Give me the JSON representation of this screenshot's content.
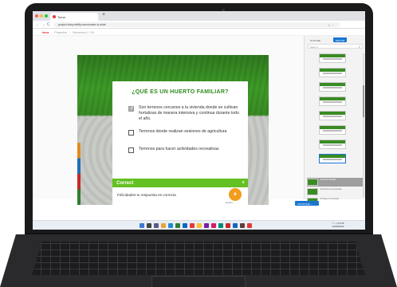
{
  "browser": {
    "tab_title": "Toma",
    "new_tab": "+",
    "url": "project-toby.netlify.com/create-is-slide",
    "nav_back": "←",
    "nav_forward": "→",
    "nav_reload": "C",
    "url_icons": "☆ ⋮"
  },
  "app": {
    "logo": "toma",
    "crumb_1": "Proyectos",
    "crumb_sep": "›",
    "crumb_2": "Secuencia 1 / 2/4"
  },
  "quiz": {
    "question": "¿QUÉ ES UN HUERTO FAMILIAR?",
    "options": [
      {
        "text": "Son terrenos cercanos a la vivienda donde se cultivan hortalizas de manera intensiva y continua durante todo el año.",
        "checked": true
      },
      {
        "text": "Terrenos donde realizan sesiones de agricultura",
        "checked": false
      },
      {
        "text": "Terrenos para hacer actividades recreativas",
        "checked": false
      }
    ]
  },
  "feedback": {
    "title": "Correct",
    "arrow": "∨",
    "message": "Felicidades tu respuesta es correcta",
    "logo_text": "Huerto"
  },
  "panel": {
    "tab_outline": "OUTLINE",
    "tab_editor": "EDITOR",
    "search_placeholder": "Search",
    "search_icon": "⌕",
    "list": [
      {
        "text": "El huerto familiar",
        "active": true
      },
      {
        "text": "El huerto en la escuela",
        "active": false
      },
      {
        "text": "El riego en el huerto",
        "active": false
      }
    ],
    "continue_label": "CONTINUE ›"
  },
  "taskbar": {
    "tray_line1": "^ ⌂ ◁ 12:45",
    "tray_line2": "12/04/2022"
  },
  "colors": {
    "accent": "#2e8b1e",
    "feedback": "#63c123",
    "brand": "#1976d2"
  }
}
